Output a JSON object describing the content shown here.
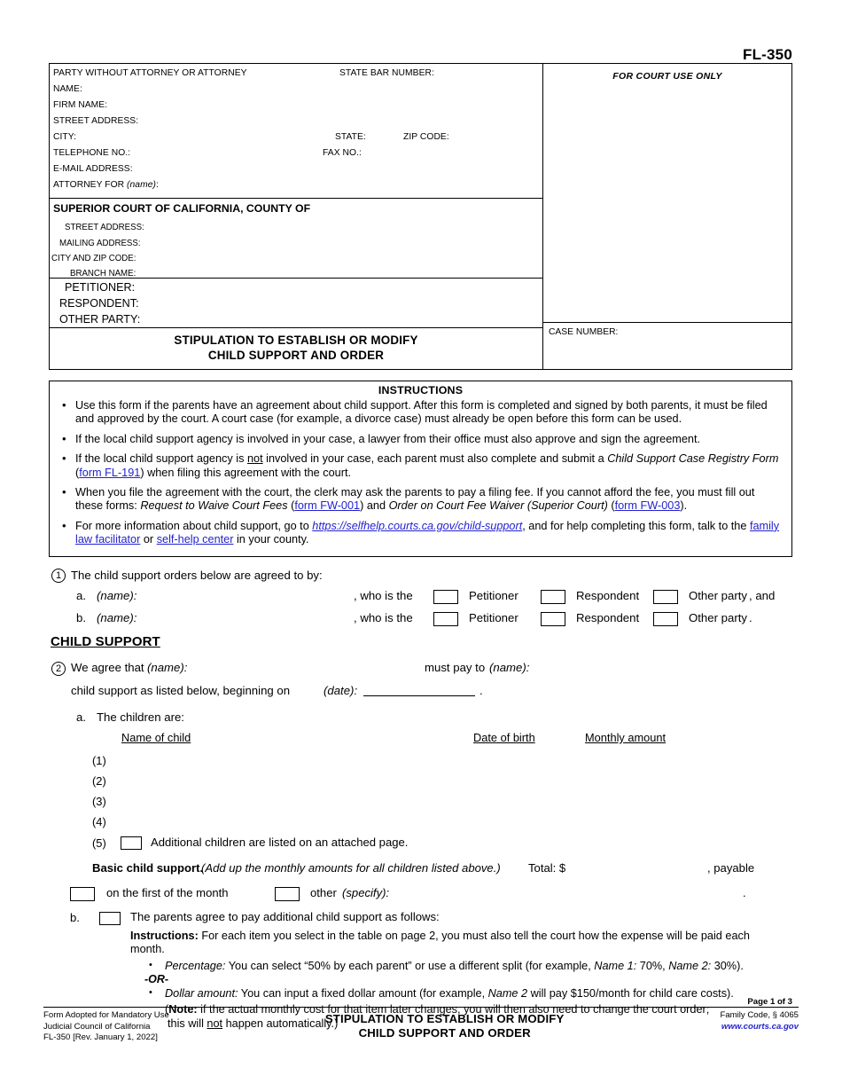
{
  "form_number": "FL-350",
  "caption": {
    "attorney": {
      "party_label": "PARTY WITHOUT ATTORNEY OR ATTORNEY",
      "state_bar_label": "STATE BAR NUMBER:",
      "name_label": "NAME:",
      "firm_label": "FIRM NAME:",
      "street_label": "STREET ADDRESS:",
      "city_label": "CITY:",
      "state_label": "STATE:",
      "zip_label": "ZIP CODE:",
      "telephone_label": "TELEPHONE NO.:",
      "fax_label": "FAX NO.:",
      "email_label": "E-MAIL ADDRESS:",
      "attorney_for_label": "ATTORNEY FOR ",
      "attorney_for_italic": "(name)",
      "attorney_for_colon": ":"
    },
    "court": {
      "title": "SUPERIOR COURT OF CALIFORNIA, COUNTY OF",
      "street_label": "STREET ADDRESS:",
      "mailing_label": "MAILING ADDRESS:",
      "city_zip_label": "CITY AND ZIP CODE:",
      "branch_label": "BRANCH NAME:"
    },
    "parties": {
      "petitioner_label": "PETITIONER:",
      "respondent_label": "RESPONDENT:",
      "other_party_label": "OTHER PARTY:"
    },
    "doc_title_line1": "STIPULATION TO ESTABLISH OR MODIFY",
    "doc_title_line2": "CHILD SUPPORT AND ORDER",
    "court_use_only": "FOR COURT USE ONLY",
    "case_number_label": "CASE NUMBER:"
  },
  "instructions": {
    "heading": "INSTRUCTIONS",
    "items": [
      {
        "id": "use-this-form",
        "parts": [
          {
            "t": "text",
            "v": "Use this form if the parents have an agreement about child support. After this form is completed and signed by both parents, it must be filed and approved by the court. A court case (for example, a divorce case) must already be open before this form can be used."
          }
        ]
      },
      {
        "id": "local-agency-involved",
        "parts": [
          {
            "t": "text",
            "v": "If the local child support agency is involved in your case, a lawyer from their office must also approve and sign the agreement."
          }
        ]
      },
      {
        "id": "local-agency-not-involved",
        "parts": [
          {
            "t": "text",
            "v": "If the local child support agency is "
          },
          {
            "t": "underline",
            "v": "not"
          },
          {
            "t": "text",
            "v": " involved in your case, each parent must also complete and submit a "
          },
          {
            "t": "italic",
            "v": "Child Support Case Registry Form"
          },
          {
            "t": "text",
            "v": " ("
          },
          {
            "t": "link",
            "v": "form FL-191"
          },
          {
            "t": "text",
            "v": ") when filing this agreement with the court."
          }
        ]
      },
      {
        "id": "filing-fee",
        "parts": [
          {
            "t": "text",
            "v": "When you file the agreement with the court, the clerk may ask the parents to pay a filing fee. If you cannot afford the fee, you must fill out these forms: "
          },
          {
            "t": "italic",
            "v": "Request to Waive Court Fees"
          },
          {
            "t": "text",
            "v": " ("
          },
          {
            "t": "link",
            "v": "form FW-001"
          },
          {
            "t": "text",
            "v": ") and "
          },
          {
            "t": "italic",
            "v": "Order on Court Fee Waiver (Superior Court)"
          },
          {
            "t": "text",
            "v": " ("
          },
          {
            "t": "link",
            "v": "form FW-003"
          },
          {
            "t": "text",
            "v": ")."
          }
        ]
      },
      {
        "id": "more-information",
        "parts": [
          {
            "t": "text",
            "v": "For more information about child support, go to  "
          },
          {
            "t": "link-italic",
            "v": "https://selfhelp.courts.ca.gov/child-support"
          },
          {
            "t": "text",
            "v": ", and for help completing this form, talk to the "
          },
          {
            "t": "link",
            "v": "family law facilitator"
          },
          {
            "t": "text",
            "v": " or "
          },
          {
            "t": "link",
            "v": "self-help center"
          },
          {
            "t": "text",
            "v": " in your county."
          }
        ]
      }
    ]
  },
  "item1": {
    "number": "1",
    "text": "The child support orders below are agreed to by:",
    "a_letter": "a.",
    "a_name": "(name):",
    "a_who": ", who is the",
    "b_letter": "b.",
    "b_name": "(name):",
    "b_who": ", who is the",
    "petitioner": "Petitioner",
    "respondent": "Respondent",
    "other_party": "Other party",
    "trailing_a": ", and",
    "trailing_b": "."
  },
  "child_support_heading": "CHILD SUPPORT",
  "item2": {
    "number": "2",
    "lead": "We agree that",
    "name1": "(name):",
    "must_pay_to": "must pay to",
    "name2": "(name):",
    "line2_pre": "child support as listed below, beginning on",
    "line2_date": "(date):",
    "line2_period": ".",
    "a_letter": "a.",
    "a_text": "The children are:",
    "col_name": "Name of child",
    "col_dob": "Date of birth",
    "col_amount": "Monthly amount",
    "rows": [
      "(1)",
      "(2)",
      "(3)",
      "(4)"
    ],
    "row5_num": "(5)",
    "row5_text": "Additional children are listed on an attached page.",
    "basic_label": "Basic child support.",
    "basic_italic": "(Add up the monthly amounts for all children listed above.)",
    "basic_total": "Total: $",
    "basic_payable": ", payable",
    "first_of_month": "on the first of the month",
    "other": "other",
    "other_specify": "(specify):",
    "other_period": ".",
    "b_letter": "b.",
    "b_text": "The parents agree to pay additional child support as follows:",
    "instructions_label": "Instructions:",
    "instructions_text": " For each item you select in the table on page 2, you must also tell the court how the expense will be paid each month.",
    "bullet_pct_label": "Percentage:",
    "bullet_pct_text_1": " You can select “50% by each parent” or use a different split (for example, ",
    "bullet_pct_name1": "Name 1:",
    "bullet_pct_text_2": " 70%, ",
    "bullet_pct_name2": "Name 2:",
    "bullet_pct_text_3": " 30%).",
    "or_divider": "-OR-",
    "bullet_dollar_label": "Dollar amount:",
    "bullet_dollar_text_1": " You can input a fixed dollar amount (for example, ",
    "bullet_dollar_name2": "Name 2",
    "bullet_dollar_text_2": " will pay $150/month for child care costs).",
    "note_open": "(",
    "note_label": "Note:",
    "note_text": " if the actual monthly cost for that item later changes, you will then also need to change the court order;",
    "note_line2_pre": "this will ",
    "note_line2_not": "not",
    "note_line2_post": " happen automatically.)"
  },
  "footer": {
    "page_of": "Page 1 of 3",
    "left_line1": "Form Adopted for Mandatory Use",
    "left_line2": "Judicial Council of California",
    "left_line3": "FL-350 [Rev. January 1, 2022]",
    "center_line1": "STIPULATION TO ESTABLISH OR MODIFY",
    "center_line2": "CHILD SUPPORT AND ORDER",
    "right_line1": "Family Code, § 4065",
    "right_line2": "www.courts.ca.gov"
  },
  "colors": {
    "link": "#2323cf",
    "text": "#000000",
    "background": "#ffffff"
  }
}
